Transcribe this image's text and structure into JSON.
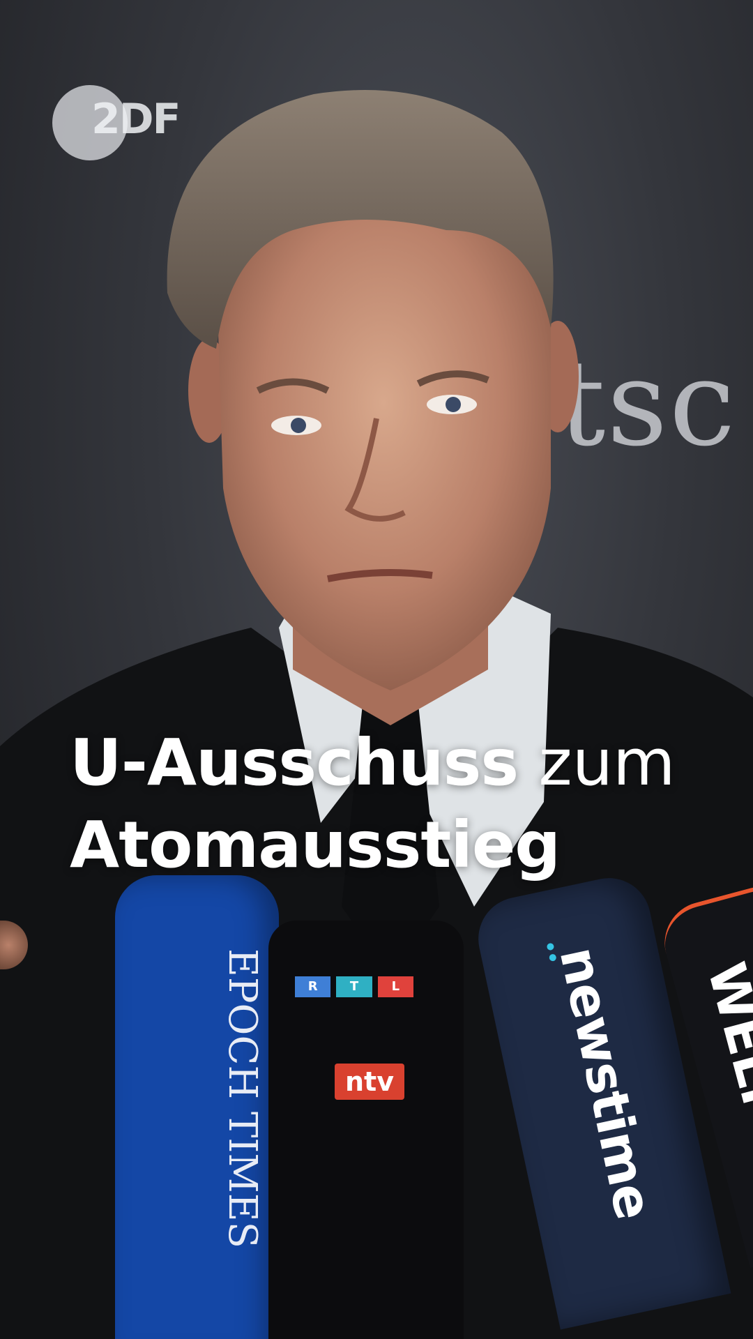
{
  "logo": {
    "text": "2DF"
  },
  "backdrop": {
    "text": "tsc"
  },
  "headline": {
    "line1_bold": "U-Ausschuss",
    "line1_light": "zum",
    "line2_bold": "Atomausstieg"
  },
  "microphones": {
    "epoch": "EPOCH TIMES",
    "rtl": [
      "R",
      "T",
      "L"
    ],
    "ntv": "ntv",
    "newstime": "newstime",
    "welt": "WELT"
  },
  "colors": {
    "epoch_blue": "#1447a6",
    "rtl_blue": "#3f7fd6",
    "rtl_teal": "#2fb0c3",
    "rtl_red": "#e0423c",
    "ntv_red": "#d9412f",
    "newstime_navy": "#1e2a44",
    "welt_orange": "#e8552d"
  }
}
